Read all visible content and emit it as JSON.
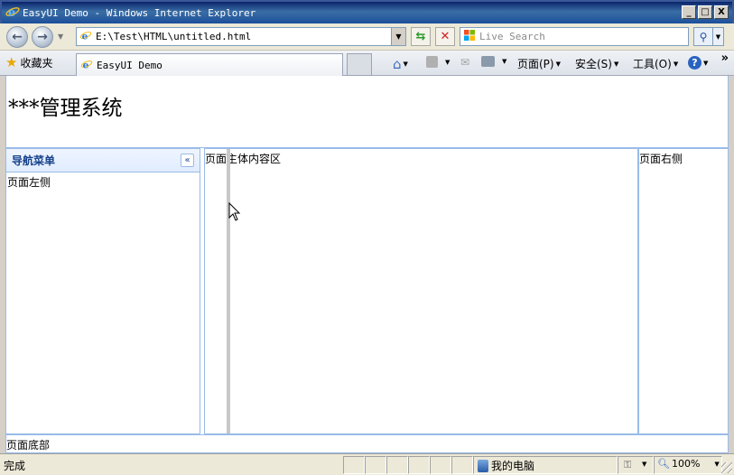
{
  "window": {
    "title": "EasyUI Demo - Windows Internet Explorer",
    "minimize_label": "_",
    "maximize_label": "□",
    "close_label": "X"
  },
  "nav": {
    "address": "E:\\Test\\HTML\\untitled.html",
    "search_placeholder": "Live Search"
  },
  "tabs": {
    "favorites_label": "收藏夹",
    "active_tab": "EasyUI Demo"
  },
  "commandbar": {
    "page_menu": "页面(P)",
    "safety_menu": "安全(S)",
    "tools_menu": "工具(O)",
    "help_glyph": "?"
  },
  "page": {
    "system_title": "***管理系统",
    "west": {
      "title": "导航菜单",
      "collapse_glyph": "«",
      "content": "页面左侧"
    },
    "center": {
      "content": "页面主体内容区"
    },
    "east": {
      "content": "页面右侧"
    },
    "south": {
      "content": "页面底部"
    }
  },
  "statusbar": {
    "status": "完成",
    "zone": "我的电脑",
    "zoom": "100%"
  },
  "colors": {
    "panel_border": "#99bbe8",
    "panel_header_text": "#15428b",
    "titlebar": "#0a246a"
  }
}
